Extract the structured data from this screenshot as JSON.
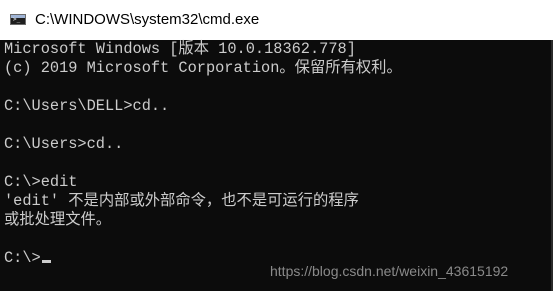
{
  "window": {
    "title": "C:\\WINDOWS\\system32\\cmd.exe",
    "icon": "cmd-icon"
  },
  "console": {
    "lines": [
      "Microsoft Windows [版本 10.0.18362.778]",
      "(c) 2019 Microsoft Corporation。保留所有权利。",
      "",
      "C:\\Users\\DELL>cd..",
      "",
      "C:\\Users>cd..",
      "",
      "C:\\>edit",
      "'edit' 不是内部或外部命令，也不是可运行的程序",
      "或批处理文件。",
      "",
      "C:\\>"
    ]
  },
  "watermark": "https://blog.csdn.net/weixin_43615192",
  "colors": {
    "console_background": "#0c0c0c",
    "console_text": "#cccccc",
    "titlebar_background": "#ffffff"
  }
}
